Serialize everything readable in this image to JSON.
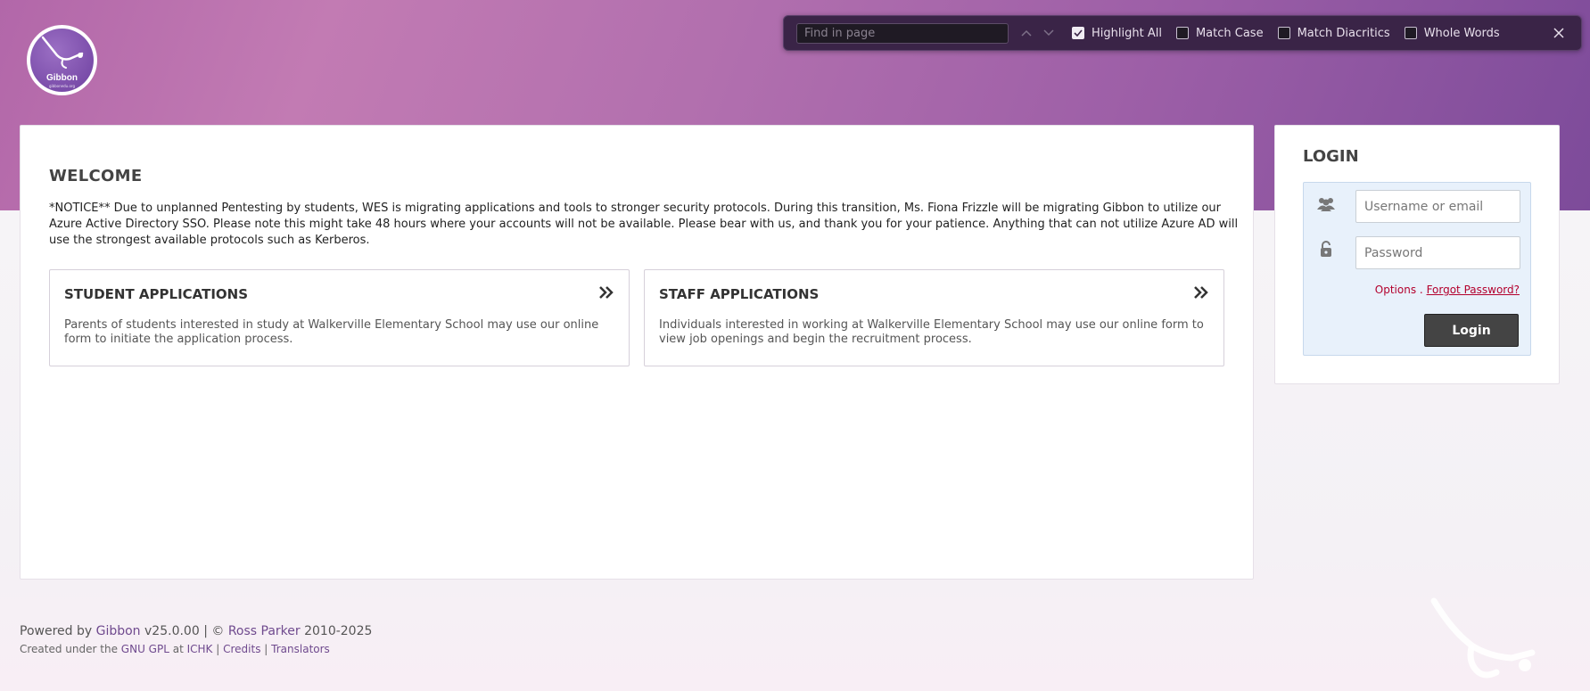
{
  "logo": {
    "name": "Gibbon",
    "sub": "gibbonedu.org"
  },
  "findbar": {
    "placeholder": "Find in page",
    "highlight_all": "Highlight All",
    "match_case": "Match Case",
    "match_diacritics": "Match Diacritics",
    "whole_words": "Whole Words",
    "highlight_all_checked": true,
    "match_case_checked": false,
    "match_diacritics_checked": false,
    "whole_words_checked": false
  },
  "main": {
    "title": "WELCOME",
    "notice": "*NOTICE** Due to unplanned Pentesting by students, WES is migrating applications and tools to stronger security protocols. During this transition, Ms. Fiona Frizzle will be migrating Gibbon to utilize our Azure Active Directory SSO. Please note this might take 48 hours where your accounts will not be available. Please bear with us, and thank you for your patience. Anything that can not utilize Azure AD will use the strongest available protocols such as Kerberos.",
    "cards": [
      {
        "title": "STUDENT APPLICATIONS",
        "description": "Parents of students interested in study at Walkerville Elementary School may use our online form to initiate the application process."
      },
      {
        "title": "STAFF APPLICATIONS",
        "description": "Individuals interested in working at Walkerville Elementary School may use our online form to view job openings and begin the recruitment process."
      }
    ]
  },
  "login": {
    "title": "LOGIN",
    "username_placeholder": "Username or email",
    "password_placeholder": "Password",
    "options_label": "Options",
    "separator": ".",
    "forgot_password": "Forgot Password?",
    "button_label": "Login"
  },
  "footer": {
    "powered_by": "Powered by",
    "gibbon_link": "Gibbon",
    "version": "v25.0.00 |",
    "copyright_symbol": "©",
    "author_link": "Ross Parker",
    "years": "2010-2025",
    "created_under": "Created under the",
    "license_link": "GNU GPL",
    "at": "at",
    "ichk_link": "ICHK",
    "sep1": "|",
    "credits_link": "Credits",
    "sep2": "|",
    "translators_link": "Translators"
  },
  "colors": {
    "header_purple": "#a96bab",
    "login_box_bg": "#e8f1fb",
    "link_red": "#b3002d",
    "footer_link": "#6f4a8e"
  }
}
